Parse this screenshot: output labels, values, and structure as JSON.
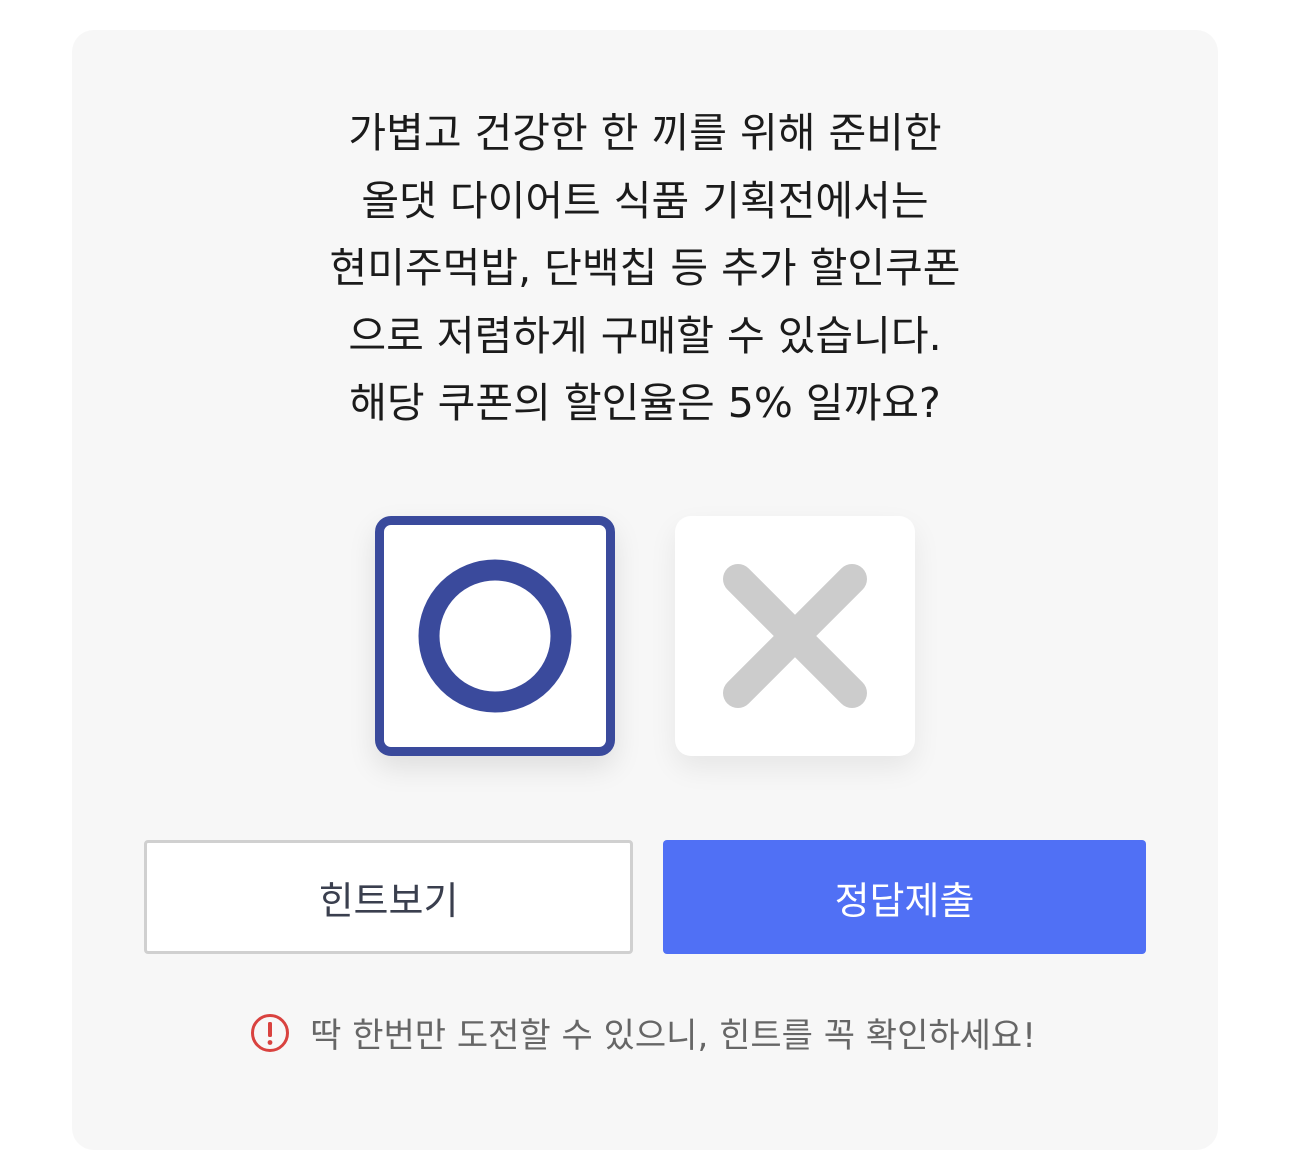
{
  "quiz": {
    "question_lines": [
      "가볍고 건강한 한 끼를 위해 준비한",
      "올댓 다이어트 식품 기획전에서는",
      "현미주먹밥, 단백칩 등 추가 할인쿠폰",
      "으로 저렴하게 구매할 수 있습니다.",
      "해당 쿠폰의 할인율은 5% 일까요?"
    ],
    "options": [
      {
        "icon": "o-icon",
        "selected": true
      },
      {
        "icon": "x-icon",
        "selected": false
      }
    ]
  },
  "buttons": {
    "hint_label": "힌트보기",
    "submit_label": "정답제출"
  },
  "notice": {
    "icon": "warning-icon",
    "text": "딱 한번만 도전할 수 있으니, 힌트를 꼭 확인하세요!"
  },
  "colors": {
    "card_bg": "#f7f7f7",
    "selected_border": "#3a4a9c",
    "o_mark": "#3a4a9c",
    "x_mark": "#cccccc",
    "submit_bg": "#5070f5",
    "warning": "#d9423f"
  }
}
